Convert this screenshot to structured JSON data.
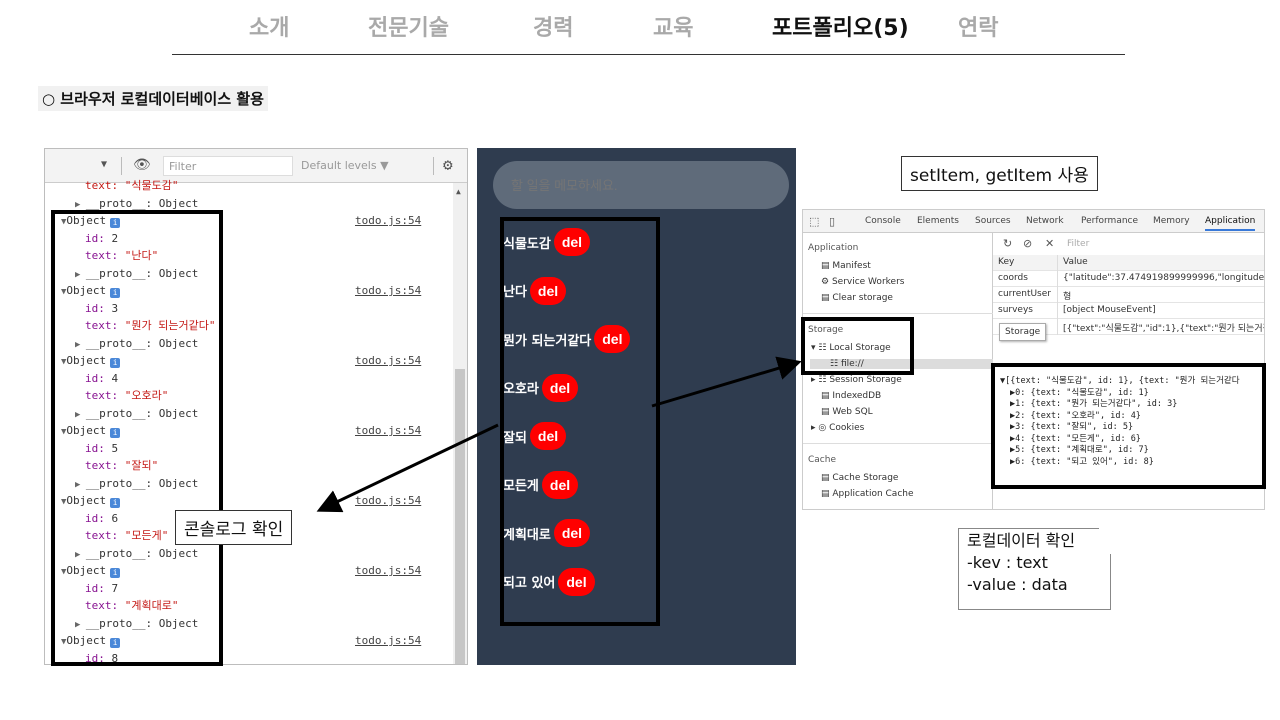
{
  "nav": {
    "items": [
      "소개",
      "전문기술",
      "경력",
      "교육",
      "포트폴리오(5)",
      "연락"
    ],
    "active_index": 4
  },
  "section_title": "○ 브라우저 로컬데이터베이스 활용",
  "console": {
    "filter_placeholder": "Filter",
    "levels_label": "Default levels ▼",
    "icons": [
      "dropdown-arrow-icon",
      "eye-icon",
      "gear-icon",
      "scroll-up-icon",
      "expand-triangle-icon",
      "info-badge-icon"
    ],
    "lines": [
      {
        "type": "partial",
        "text": "text: \"식물도감\""
      },
      {
        "type": "proto",
        "text": "__proto__: Object"
      },
      {
        "type": "obj",
        "text": "Object",
        "link": "todo.js:54"
      },
      {
        "type": "id",
        "key": "id:",
        "value": "2"
      },
      {
        "type": "text",
        "key": "text:",
        "value": "\"난다\""
      },
      {
        "type": "proto",
        "text": "__proto__: Object"
      },
      {
        "type": "obj",
        "text": "Object",
        "link": "todo.js:54"
      },
      {
        "type": "id",
        "key": "id:",
        "value": "3"
      },
      {
        "type": "text",
        "key": "text:",
        "value": "\"뭔가 되는거같다\""
      },
      {
        "type": "proto",
        "text": "__proto__: Object"
      },
      {
        "type": "obj",
        "text": "Object",
        "link": "todo.js:54"
      },
      {
        "type": "id",
        "key": "id:",
        "value": "4"
      },
      {
        "type": "text",
        "key": "text:",
        "value": "\"오호라\""
      },
      {
        "type": "proto",
        "text": "__proto__: Object"
      },
      {
        "type": "obj",
        "text": "Object",
        "link": "todo.js:54"
      },
      {
        "type": "id",
        "key": "id:",
        "value": "5"
      },
      {
        "type": "text",
        "key": "text:",
        "value": "\"잘되\""
      },
      {
        "type": "proto",
        "text": "__proto__: Object"
      },
      {
        "type": "obj",
        "text": "Object",
        "link": "todo.js:54"
      },
      {
        "type": "id",
        "key": "id:",
        "value": "6"
      },
      {
        "type": "text",
        "key": "text:",
        "value": "\"모든게\""
      },
      {
        "type": "proto",
        "text": "__proto__: Object"
      },
      {
        "type": "obj",
        "text": "Object",
        "link": "todo.js:54"
      },
      {
        "type": "id",
        "key": "id:",
        "value": "7"
      },
      {
        "type": "text",
        "key": "text:",
        "value": "\"계획대로\""
      },
      {
        "type": "proto",
        "text": "__proto__: Object"
      },
      {
        "type": "obj",
        "text": "Object",
        "link": "todo.js:54"
      },
      {
        "type": "id",
        "key": "id:",
        "value": "8"
      }
    ]
  },
  "todo": {
    "placeholder": "할 일을 메모하세요.",
    "del_label": "del",
    "items": [
      "식물도감",
      "난다",
      "뭔가 되는거같다",
      "오호라",
      "잘되",
      "모든게",
      "계획대로",
      "되고 있어"
    ]
  },
  "devtools": {
    "tabs": [
      "Console",
      "Elements",
      "Sources",
      "Network",
      "Performance",
      "Memory",
      "Application"
    ],
    "active_tab": "Application",
    "sidebar": {
      "application_header": "Application",
      "application_items": [
        "Manifest",
        "Service Workers",
        "Clear storage"
      ],
      "storage_header": "Storage",
      "local_storage": "Local Storage",
      "file_item": "file://",
      "storage_items": [
        "Session Storage",
        "IndexedDB",
        "Web SQL",
        "Cookies"
      ],
      "cache_header": "Cache",
      "cache_items": [
        "Cache Storage",
        "Application Cache"
      ]
    },
    "filter_placeholder": "Filter",
    "table": {
      "headers": [
        "Key",
        "Value"
      ],
      "rows": [
        {
          "key": "coords",
          "value": "{\"latitude\":37.474919899999996,\"longitude\":126"
        },
        {
          "key": "currentUser",
          "value": "형"
        },
        {
          "key": "surveys",
          "value": "[object MouseEvent]"
        },
        {
          "key": "",
          "value": "[{\"text\":\"식물도감\",\"id\":1},{\"text\":\"뭔가 되는거같"
        }
      ]
    },
    "tooltip": "Storage",
    "json_lines": [
      "▼[{text: \"식물도감\", id: 1}, {text: \"뭔가 되는거같다",
      "▶0: {text: \"식물도감\", id: 1}",
      "▶1: {text: \"뭔가 되는거같다\", id: 3}",
      "▶2: {text: \"오호라\", id: 4}",
      "▶3: {text: \"잘되\", id: 5}",
      "▶4: {text: \"모든게\", id: 6}",
      "▶5: {text: \"계획대로\", id: 7}",
      "▶6: {text: \"되고 있어\", id: 8}"
    ]
  },
  "labels": {
    "console_confirm": "콘솔로그 확인",
    "setitem": "setItem, getItem 사용",
    "note_title": "로컬데이터 확인",
    "note_key": "-kev : text",
    "note_value": "-value : data"
  },
  "colors": {
    "todo_bg": "#2f3c4f",
    "del_red": "#ff0000",
    "nav_inactive": "#a9a9a9"
  }
}
